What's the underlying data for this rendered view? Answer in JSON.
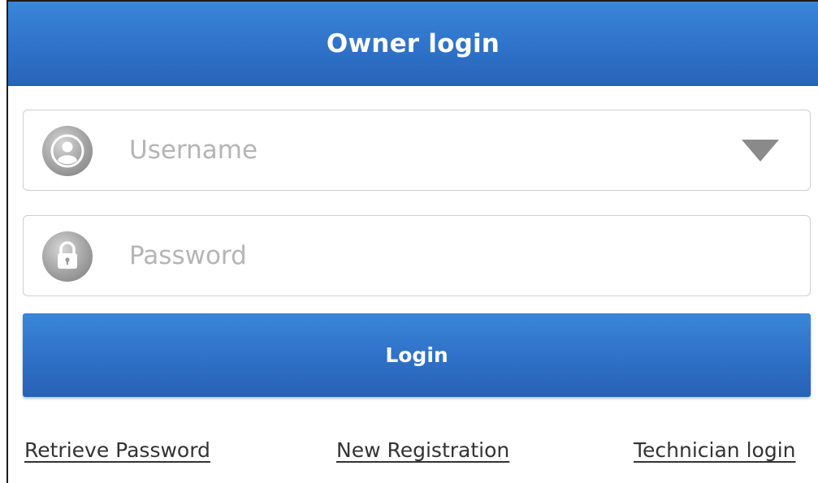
{
  "header": {
    "title": "Owner login"
  },
  "username": {
    "placeholder": "Username",
    "value": "",
    "icon": "user-icon",
    "dropdown_icon": "triangle-down-icon"
  },
  "password": {
    "placeholder": "Password",
    "value": "",
    "icon": "lock-icon"
  },
  "login_button": {
    "label": "Login"
  },
  "links": {
    "retrieve_password": "Retrieve Password",
    "new_registration": "New Registration",
    "technician_login": "Technician login"
  },
  "colors": {
    "header_blue": "#2f72c9",
    "button_blue": "#2f72c9",
    "placeholder_gray": "#b5b5b5",
    "icon_gray": "#9a9a9a"
  }
}
